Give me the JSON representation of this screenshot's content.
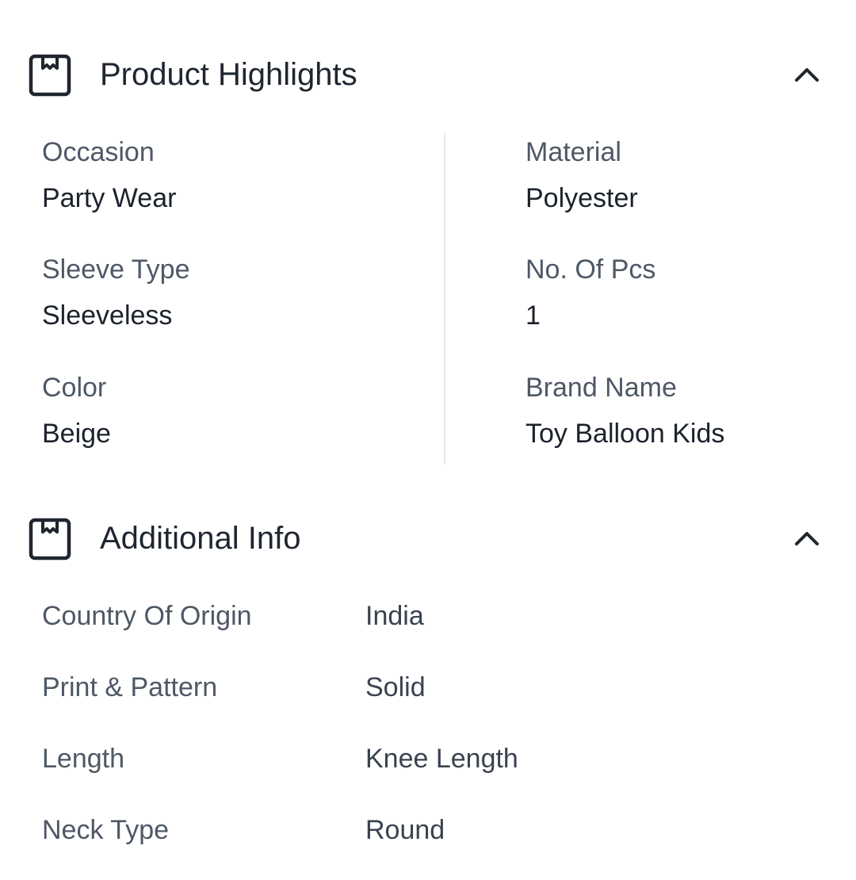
{
  "product_highlights": {
    "title": "Product Highlights",
    "icon": "package-icon",
    "toggle_icon": "chevron-up-icon",
    "items": [
      {
        "label": "Occasion",
        "value": "Party Wear"
      },
      {
        "label": "Material",
        "value": "Polyester"
      },
      {
        "label": "Sleeve Type",
        "value": "Sleeveless"
      },
      {
        "label": "No. Of Pcs",
        "value": "1"
      },
      {
        "label": "Color",
        "value": "Beige"
      },
      {
        "label": "Brand Name",
        "value": "Toy Balloon Kids"
      }
    ]
  },
  "additional_info": {
    "title": "Additional Info",
    "icon": "package-icon",
    "toggle_icon": "chevron-up-icon",
    "rows": [
      {
        "label": "Country Of Origin",
        "value": "India"
      },
      {
        "label": "Print & Pattern",
        "value": "Solid"
      },
      {
        "label": "Length",
        "value": "Knee Length"
      },
      {
        "label": "Neck Type",
        "value": "Round"
      }
    ]
  },
  "colors": {
    "text_primary": "#1f2630",
    "text_secondary": "#4e5866",
    "divider": "#e4e7eb"
  }
}
